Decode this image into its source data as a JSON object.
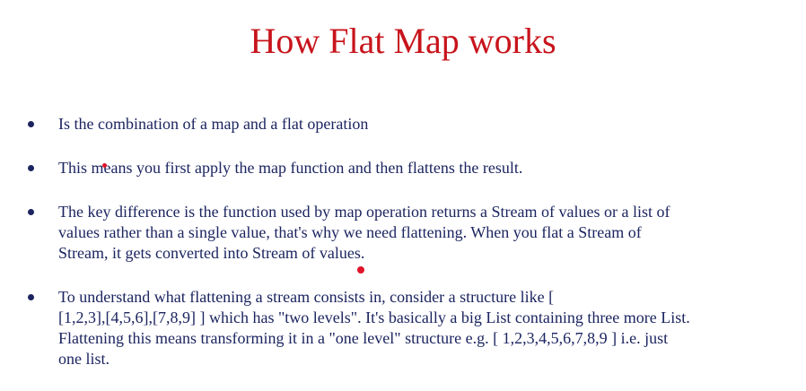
{
  "slide": {
    "title": "How Flat Map works",
    "title_color": "#c8141c",
    "text_color": "#1c2560",
    "bullets": [
      {
        "text": "Is the combination of a map and a flat operation"
      },
      {
        "text": "This means you first apply the map function and then flattens the result."
      },
      {
        "text": "The key difference is the function used by map operation returns a Stream of values or a list of\nvalues rather than a single value, that's why we need flattening. When you flat a Stream of\nStream, it gets converted into Stream of values."
      },
      {
        "text": "To understand what flattening a stream consists in, consider a structure like [\n[1,2,3],[4,5,6],[7,8,9] ] which has \"two levels\". It's basically a big List containing three more List.\nFlattening this means transforming it in a \"one level\" structure e.g. [ 1,2,3,4,5,6,7,8,9 ] i.e. just\none list."
      }
    ]
  }
}
